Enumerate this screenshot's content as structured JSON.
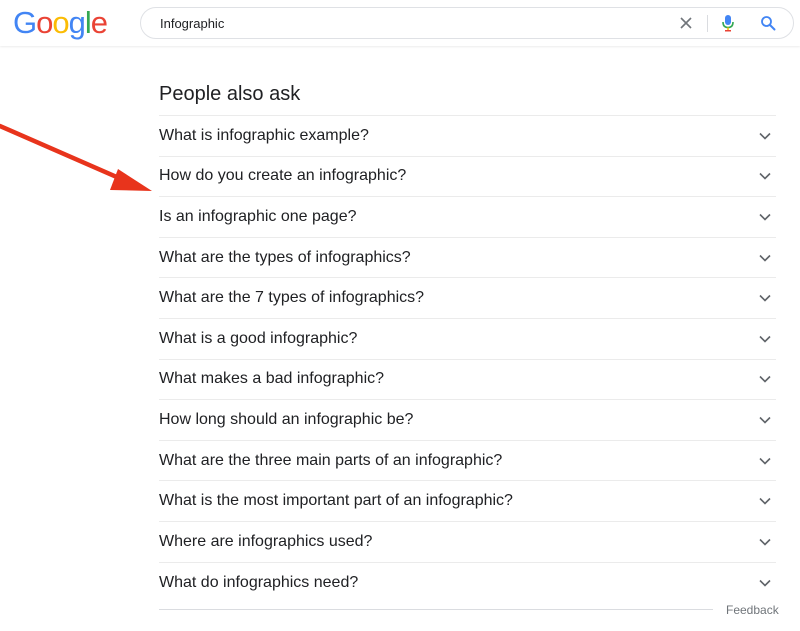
{
  "logo": {
    "letters": [
      "G",
      "o",
      "o",
      "g",
      "l",
      "e"
    ],
    "colors": [
      "#4285F4",
      "#EA4335",
      "#FBBC05",
      "#4285F4",
      "#34A853",
      "#EA4335"
    ]
  },
  "search": {
    "value": "Infographic",
    "clear_icon": "close-icon",
    "mic_icon": "microphone-icon",
    "search_icon": "search-icon"
  },
  "paa": {
    "title": "People also ask",
    "questions": [
      "What is infographic example?",
      "How do you create an infographic?",
      "Is an infographic one page?",
      "What are the types of infographics?",
      "What are the 7 types of infographics?",
      "What is a good infographic?",
      "What makes a bad infographic?",
      "How long should an infographic be?",
      "What are the three main parts of an infographic?",
      "What is the most important part of an infographic?",
      "Where are infographics used?",
      "What do infographics need?"
    ],
    "expand_icon": "chevron-down-icon"
  },
  "feedback": "Feedback",
  "annotation": {
    "arrow_color": "#E8341C",
    "points_to_question": "How do you create an infographic?"
  }
}
